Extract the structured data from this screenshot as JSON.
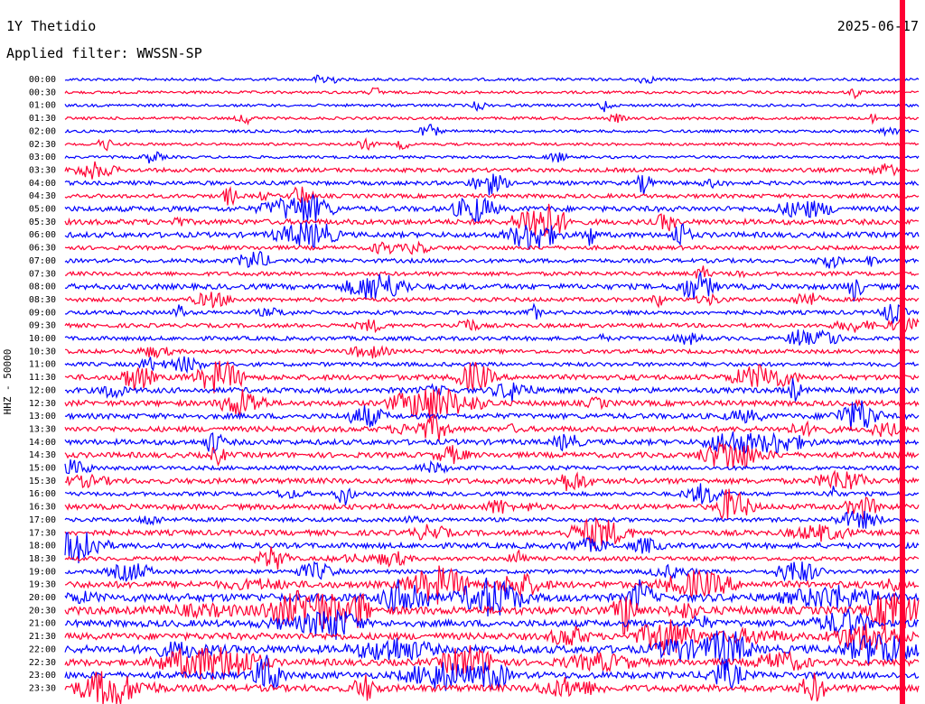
{
  "header": {
    "station": "1Y Thetidio",
    "date": "2025-06-17",
    "filter": "Applied filter: WWSSN-SP",
    "channel": "HHZ - 50000"
  },
  "colors": {
    "trace_a": "#0000ff",
    "trace_b": "#ff0033",
    "marker": "#ff0033"
  },
  "chart_data": {
    "type": "line",
    "title": "1Y Thetidio",
    "subtitle": "Applied filter: WWSSN-SP",
    "ylabel": "HHZ - 50000",
    "xlabel": "",
    "grid": false,
    "legend": "none",
    "row_labels": [
      "00:00",
      "00:30",
      "01:00",
      "01:30",
      "02:00",
      "02:30",
      "03:00",
      "03:30",
      "04:00",
      "04:30",
      "05:00",
      "05:30",
      "06:00",
      "06:30",
      "07:00",
      "07:30",
      "08:00",
      "08:30",
      "09:00",
      "09:30",
      "10:00",
      "10:30",
      "11:00",
      "11:30",
      "12:00",
      "12:30",
      "13:00",
      "13:30",
      "14:00",
      "14:30",
      "15:00",
      "15:30",
      "16:00",
      "16:30",
      "17:00",
      "17:30",
      "18:00",
      "18:30",
      "19:00",
      "19:30",
      "20:00",
      "20:30",
      "21:00",
      "21:30",
      "22:00",
      "22:30",
      "23:00",
      "23:30"
    ],
    "row_activity": [
      1,
      1,
      1,
      1,
      1,
      1,
      1,
      2,
      2,
      2,
      3,
      3,
      3,
      2,
      2,
      2,
      3,
      2,
      2,
      2,
      2,
      2,
      2,
      3,
      3,
      3,
      3,
      3,
      3,
      3,
      2,
      3,
      2,
      3,
      2,
      3,
      3,
      2,
      2,
      4,
      5,
      5,
      4,
      4,
      5,
      4,
      4,
      4
    ]
  }
}
